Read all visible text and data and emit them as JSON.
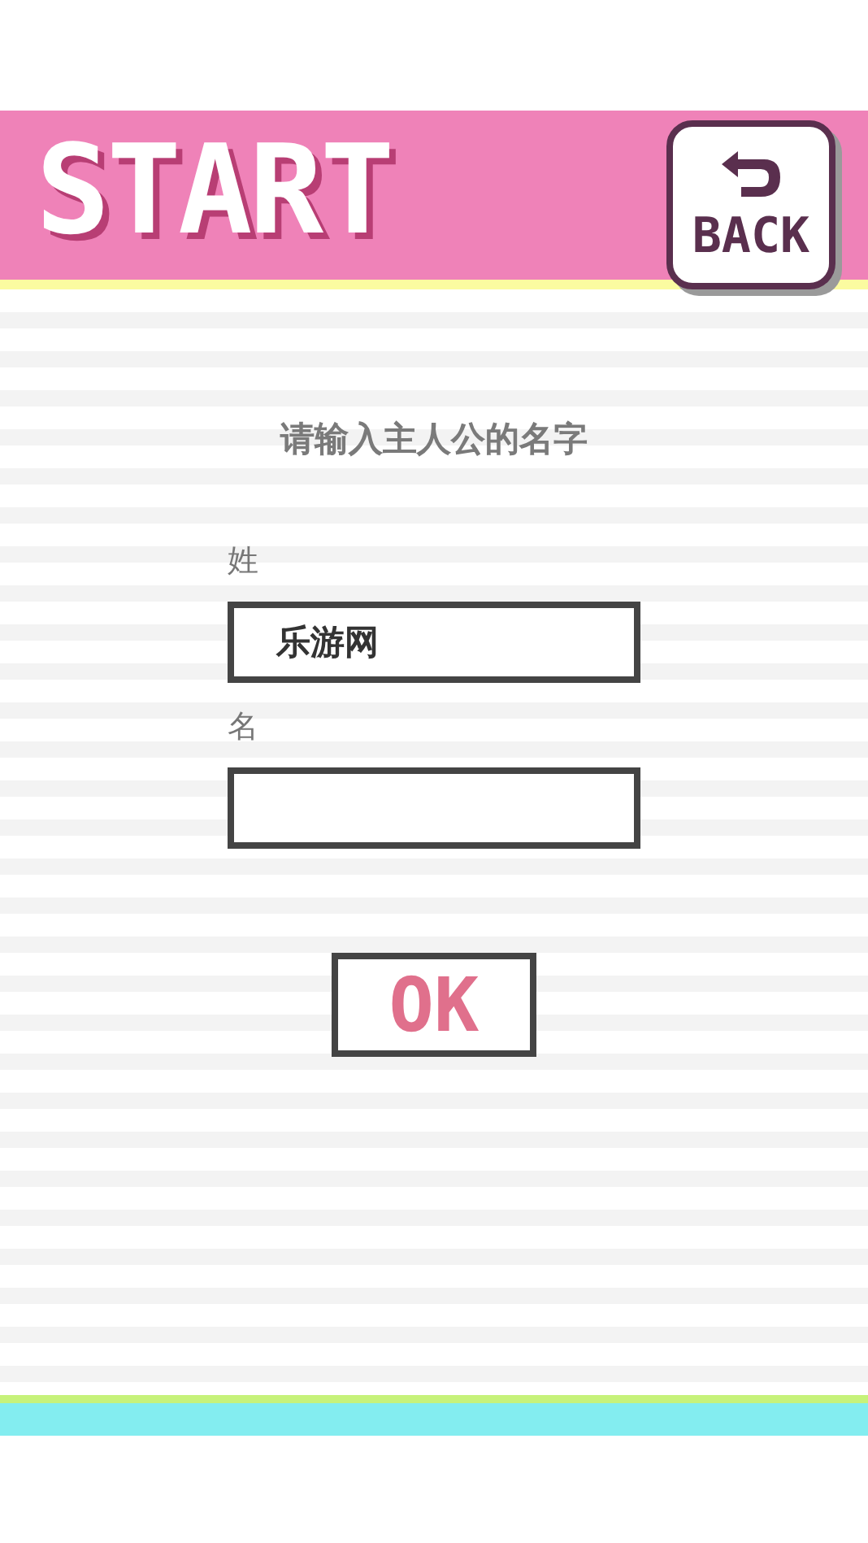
{
  "header": {
    "title": "START",
    "back_button": "BACK"
  },
  "prompt": "请输入主人公的名字",
  "fields": [
    {
      "label": "姓",
      "value": "乐游网"
    },
    {
      "label": "名"
    }
  ],
  "ok_button": "OK"
}
